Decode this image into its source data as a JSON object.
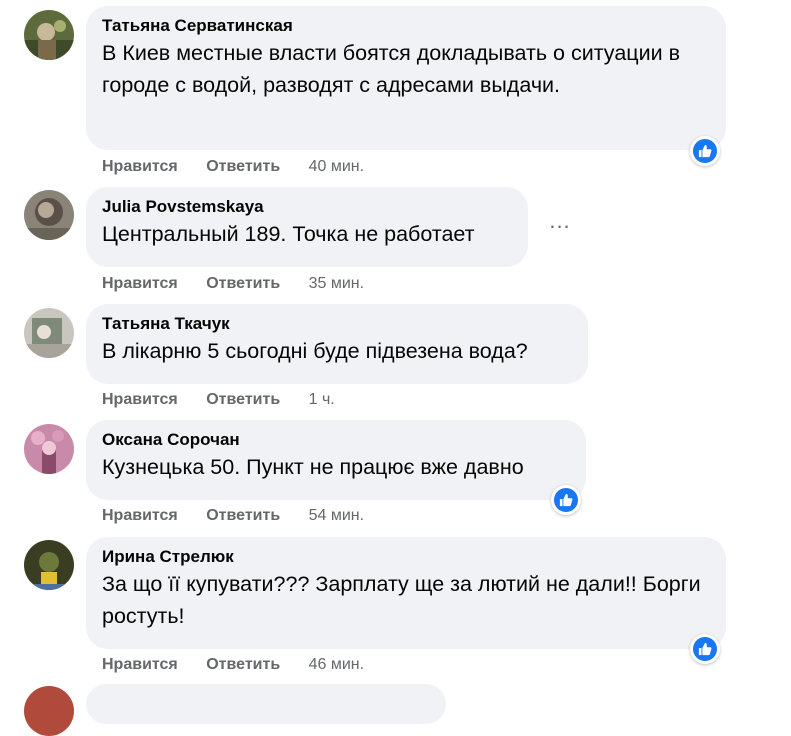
{
  "comments": [
    {
      "author": "Татьяна Серватинская",
      "text": "В Киев местные власти боятся докладывать о ситуации в городе с водой, разводят с адресами выдачи.",
      "like_label": "Нравится",
      "reply_label": "Ответить",
      "time": "40 мин.",
      "reaction": "like-icon"
    },
    {
      "author": "Julia Povstemskaya",
      "text": "Центральный 189. Точка не работает",
      "like_label": "Нравится",
      "reply_label": "Ответить",
      "time": "35 мин.",
      "more": "..."
    },
    {
      "author": "Татьяна Ткачук",
      "text": "В лікарню 5 сьогодні буде підвезена вода?",
      "like_label": "Нравится",
      "reply_label": "Ответить",
      "time": "1 ч."
    },
    {
      "author": "Оксана Сорочан",
      "text": "Кузнецька 50. Пункт не працює вже давно",
      "like_label": "Нравится",
      "reply_label": "Ответить",
      "time": "54 мин.",
      "reaction": "like-icon"
    },
    {
      "author": "Ирина Стрелюк",
      "text": "За що її купувати??? Зарплату ще за лютий не дали!! Борги ростуть!",
      "like_label": "Нравится",
      "reply_label": "Ответить",
      "time": "46 мин.",
      "reaction": "like-icon"
    }
  ],
  "colors": {
    "bubble": "#f0f2f5",
    "meta_text": "#65676b",
    "like_blue": "#1877f2"
  }
}
